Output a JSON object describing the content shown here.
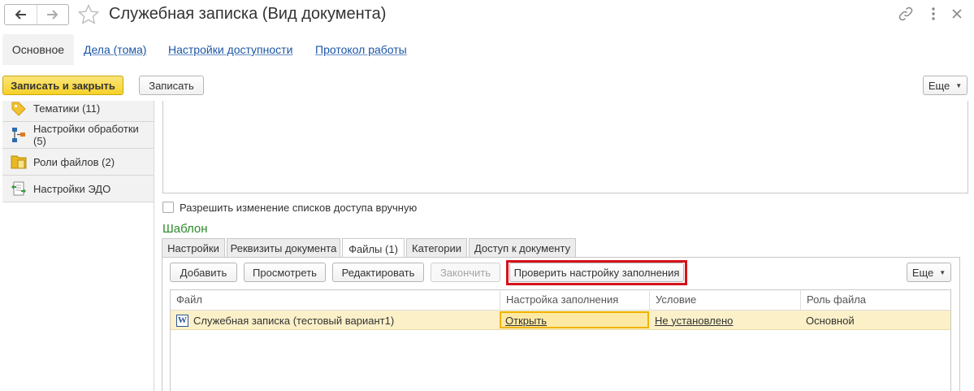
{
  "window": {
    "title": "Служебная записка (Вид документа)"
  },
  "tabs": [
    {
      "label": "Основное"
    },
    {
      "label": "Дела (тома)"
    },
    {
      "label": "Настройки доступности"
    },
    {
      "label": "Протокол работы"
    }
  ],
  "toolbar": {
    "save_close_label": "Записать и закрыть",
    "save_label": "Записать",
    "more_label": "Еще"
  },
  "sidebar": {
    "items": [
      {
        "label": "Тематики (11)",
        "icon": "tag-icon"
      },
      {
        "label": "Настройки обработки (5)",
        "icon": "process-diagram-icon"
      },
      {
        "label": "Роли файлов (2)",
        "icon": "file-roles-icon"
      },
      {
        "label": "Настройки ЭДО",
        "icon": "edo-settings-icon"
      }
    ]
  },
  "access": {
    "checkbox_label": "Разрешить изменение списков доступа вручную",
    "checked": false
  },
  "template": {
    "title": "Шаблон",
    "tabs": [
      {
        "label": "Настройки"
      },
      {
        "label": "Реквизиты документа"
      },
      {
        "label": "Файлы (1)"
      },
      {
        "label": "Категории"
      },
      {
        "label": "Доступ к документу"
      }
    ],
    "active_tab": "Файлы (1)",
    "buttons": {
      "add": "Добавить",
      "view": "Просмотреть",
      "edit": "Редактировать",
      "finish": "Закончить",
      "check_fill": "Проверить настройку заполнения",
      "more": "Еще"
    },
    "table": {
      "columns": [
        "Файл",
        "Настройка заполнения",
        "Условие",
        "Роль файла"
      ],
      "rows": [
        {
          "file": "Служебная записка (тестовый вариант1)",
          "fill_setting": "Открыть",
          "condition": "Не установлено",
          "role": "Основной"
        }
      ]
    }
  },
  "colors": {
    "accent_yellow": "#f6d128",
    "link_blue": "#1b56a5",
    "section_green": "#2b8a2b",
    "highlight_red": "#d5121b",
    "selected_row": "#fbf0c8"
  }
}
